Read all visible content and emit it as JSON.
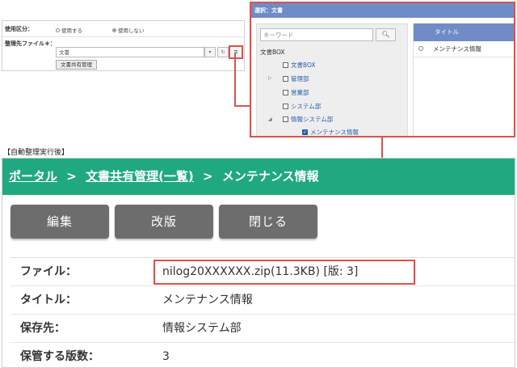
{
  "settings_form": {
    "usage_label": "使用区分：",
    "usage_options": [
      "使用する",
      "使用しない"
    ],
    "usage_selected": "使用しない",
    "dest_label": "整理先ファイル＊：",
    "dest_value": "文書",
    "share_button": "文書共有管理"
  },
  "dialog": {
    "title": "選択：文書",
    "keyword_placeholder": "キーワード",
    "root": "文書BOX",
    "tree": [
      {
        "label": "文書BOX",
        "checked": false
      },
      {
        "label": "管理部",
        "checked": false
      },
      {
        "label": "営業部",
        "checked": false
      },
      {
        "label": "システム部",
        "checked": false
      },
      {
        "label": "情報システム部",
        "checked": false
      },
      {
        "label": "メンテナンス情報",
        "checked": true
      }
    ],
    "list_header": "タイトル",
    "list_rows": [
      "メンテナンス情報"
    ]
  },
  "after_label": "【自動整理実行後】",
  "page": {
    "breadcrumb": {
      "portal": "ポータル",
      "sep": ">",
      "doc_share": "文書共有管理(一覧)",
      "current": "メンテナンス情報"
    },
    "buttons": {
      "edit": "編集",
      "revise": "改版",
      "close": "閉じる"
    },
    "details": [
      {
        "key": "ファイル：",
        "value": "nilog20XXXXXX.zip(11.3KB) [版: 3]"
      },
      {
        "key": "タイトル：",
        "value": "メンテナンス情報"
      },
      {
        "key": "保存先：",
        "value": "情報システム部"
      },
      {
        "key": "保管する版数：",
        "value": "3"
      }
    ]
  },
  "colors": {
    "accent": "#20a980",
    "highlight": "#d9534f",
    "dialog_header": "#6f8cc6",
    "button": "#6d6d6d"
  }
}
